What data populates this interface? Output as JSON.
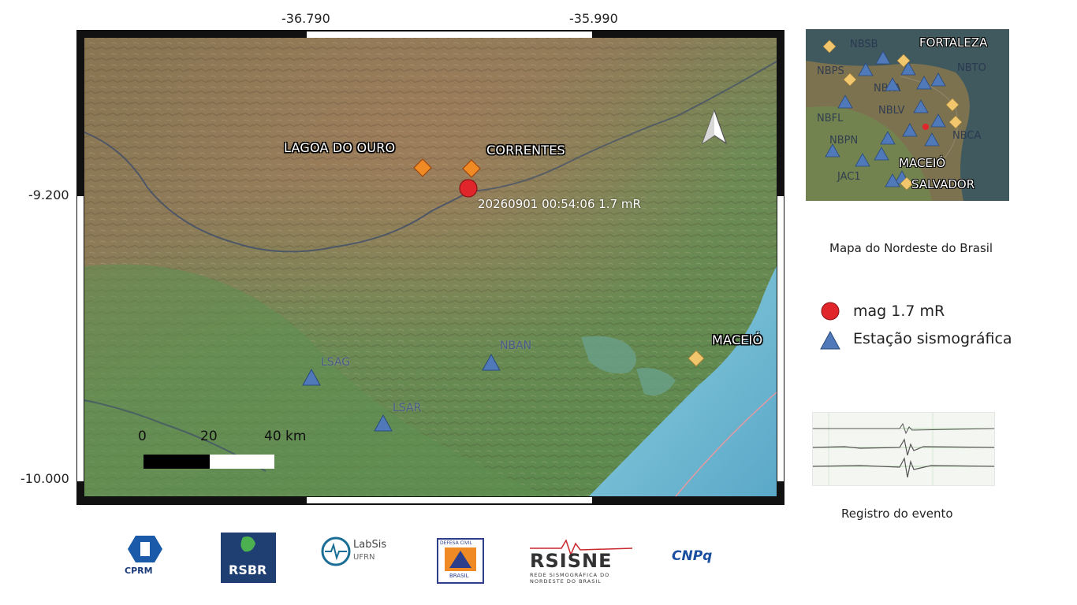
{
  "map": {
    "coords": {
      "lon_left": "-36.790",
      "lon_right": "-35.990",
      "lat_top": "-9.200",
      "lat_bottom": "-10.000"
    },
    "places": [
      {
        "name": "LAGOA DO OURO"
      },
      {
        "name": "CORRENTES"
      },
      {
        "name": "MACEIÓ"
      }
    ],
    "event_label": "20260901 00:54:06 1.7 mR",
    "stations": [
      {
        "code": "LSAG"
      },
      {
        "code": "NBAN"
      },
      {
        "code": "LSAR"
      }
    ],
    "scale": {
      "zero": "0",
      "mid": "20",
      "end": "40 km"
    },
    "colors": {
      "event": "#e0262b",
      "station": "#4f79b8",
      "town": "#f08a24",
      "capital": "#f2c66c",
      "ocean": "#7fc4d8",
      "terrain_low": "#5f8a52",
      "terrain_high": "#9a7a55"
    },
    "north_icon": "north-arrow-icon"
  },
  "inset": {
    "stations": [
      "NBSB",
      "NBPS",
      "NBPA",
      "NBLV",
      "NBFL",
      "NBPN",
      "NBCA",
      "JAC1",
      "NBTO"
    ],
    "cities": [
      "FORTALEZA",
      "MACEIÓ",
      "SALVADOR"
    ],
    "caption": "Mapa do Nordeste do Brasil"
  },
  "legend": {
    "event_label": "mag 1.7 mR",
    "station_label": "Estação sismográfica"
  },
  "record": {
    "caption": "Registro do evento"
  },
  "logos": [
    {
      "name": "CPRM"
    },
    {
      "name": "RSBR"
    },
    {
      "name": "LabSis",
      "sub": "UFRN"
    },
    {
      "name": "DEFESA CIVIL",
      "sub": "BRASIL"
    },
    {
      "name": "RSISNE",
      "sub": "REDE SISMOGRÁFICA DO NORDESTE DO BRASIL"
    },
    {
      "name": "CNPq"
    }
  ]
}
